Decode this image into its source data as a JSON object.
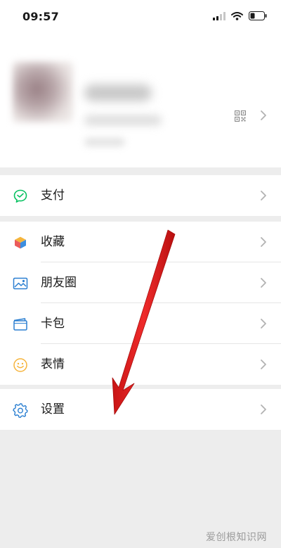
{
  "status_bar": {
    "time": "09:57"
  },
  "profile": {
    "qr_icon": "qr-code-icon",
    "chevron": "chevron-right-icon"
  },
  "menu": {
    "pay": {
      "label": "支付",
      "icon": "pay-icon",
      "color": "#07c160"
    },
    "favorites": {
      "label": "收藏",
      "icon": "favorites-cube-icon"
    },
    "moments": {
      "label": "朋友圈",
      "icon": "moments-image-icon",
      "color": "#2b7fd1"
    },
    "cards": {
      "label": "卡包",
      "icon": "cards-wallet-icon",
      "color": "#2b7fd1"
    },
    "stickers": {
      "label": "表情",
      "icon": "sticker-smiley-icon",
      "color": "#f6b43c"
    },
    "settings": {
      "label": "设置",
      "icon": "gear-icon",
      "color": "#2b7fd1"
    }
  },
  "annotation": {
    "arrow_color": "#e12222"
  },
  "watermark": {
    "text": "爱创根知识网"
  },
  "colors": {
    "background": "#ededed",
    "surface": "#ffffff",
    "text": "#1a1a1a",
    "chevron": "#b2b2b2"
  }
}
